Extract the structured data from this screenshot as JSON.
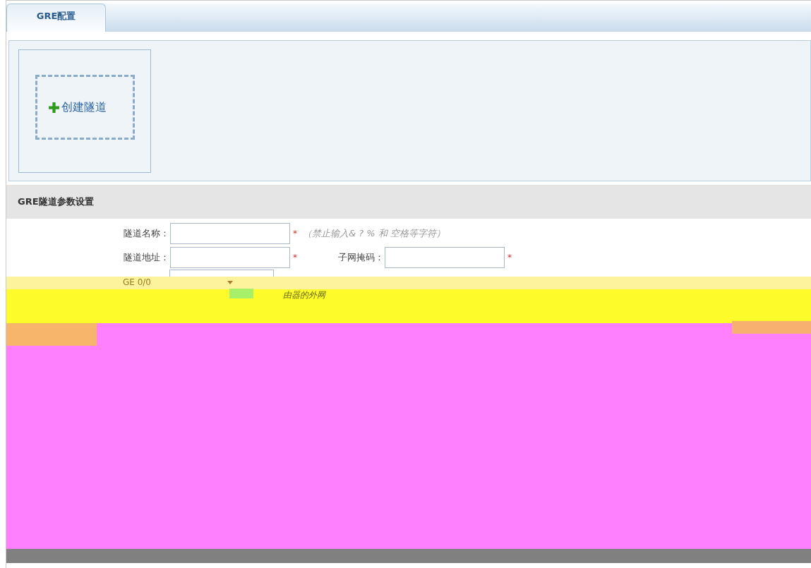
{
  "tabs": [
    {
      "label": "GRE配置",
      "selected": true
    }
  ],
  "create_button": {
    "label": "创建隧道"
  },
  "section": {
    "title": "GRE隧道参数设置"
  },
  "fields": [
    {
      "label": "隧道名称：",
      "mark": "*",
      "hint": "（禁止输入& ? % 和 空格等字符）"
    },
    {
      "label": "隧道地址：",
      "mark": "*",
      "pair": {
        "label": "子网掩码：",
        "mark": "*"
      }
    }
  ],
  "interface_row": {
    "value": "GE 0/0",
    "hint": "由器的外网"
  }
}
